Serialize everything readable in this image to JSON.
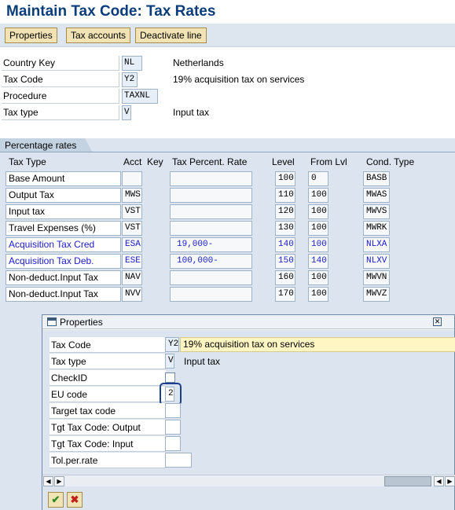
{
  "title": "Maintain Tax Code: Tax Rates",
  "toolbar": {
    "properties": "Properties",
    "tax_accounts": "Tax accounts",
    "deactivate_line": "Deactivate line"
  },
  "header": {
    "country_key_label": "Country Key",
    "country_key_value": "NL",
    "country_name": "Netherlands",
    "tax_code_label": "Tax Code",
    "tax_code_value": "Y2",
    "tax_code_desc": "19% acquisition tax on services",
    "procedure_label": "Procedure",
    "procedure_value": "TAXNL",
    "tax_type_label": "Tax type",
    "tax_type_value": "V",
    "tax_type_desc": "Input tax"
  },
  "rates": {
    "tab_label": "Percentage rates",
    "columns": {
      "tax_type": "Tax Type",
      "acct_key": "Acct  Key",
      "rate": "Tax Percent. Rate",
      "level": "Level",
      "from_lvl": "From Lvl",
      "cond_type": "Cond. Type"
    },
    "rows": [
      {
        "tax_type": "Base Amount",
        "acct_key": "",
        "rate": "",
        "level": "100",
        "from_lvl": "0",
        "cond_type": "BASB"
      },
      {
        "tax_type": "Output Tax",
        "acct_key": "MWS",
        "rate": "",
        "level": "110",
        "from_lvl": "100",
        "cond_type": "MWAS"
      },
      {
        "tax_type": "Input tax",
        "acct_key": "VST",
        "rate": "",
        "level": "120",
        "from_lvl": "100",
        "cond_type": "MWVS"
      },
      {
        "tax_type": "Travel Expenses (%)",
        "acct_key": "VST",
        "rate": "",
        "level": "130",
        "from_lvl": "100",
        "cond_type": "MWRK"
      },
      {
        "tax_type": "Acquisition Tax Cred",
        "acct_key": "ESA",
        "rate": "19,000-",
        "level": "140",
        "from_lvl": "100",
        "cond_type": "NLXA"
      },
      {
        "tax_type": "Acquisition Tax Deb.",
        "acct_key": "ESE",
        "rate": "100,000-",
        "level": "150",
        "from_lvl": "140",
        "cond_type": "NLXV"
      },
      {
        "tax_type": "Non-deduct.Input Tax",
        "acct_key": "NAV",
        "rate": "",
        "level": "160",
        "from_lvl": "100",
        "cond_type": "MWVN"
      },
      {
        "tax_type": "Non-deduct.Input Tax",
        "acct_key": "NVV",
        "rate": "",
        "level": "170",
        "from_lvl": "100",
        "cond_type": "MWVZ"
      }
    ],
    "highlight_color": "#1a1acc"
  },
  "dialog": {
    "title": "Properties",
    "tax_code_label": "Tax Code",
    "tax_code_value": "Y2",
    "tax_code_desc": "19% acquisition tax on services",
    "tax_type_label": "Tax type",
    "tax_type_value": "V",
    "tax_type_desc": "Input tax",
    "check_id_label": "CheckID",
    "eu_code_label": "EU code",
    "eu_code_value": "2",
    "target_tax_code_label": "Target tax code",
    "tgt_output_label": "Tgt Tax Code: Output",
    "tgt_input_label": "Tgt Tax Code: Input",
    "tol_label": "Tol.per.rate",
    "confirm_icon": "check-icon",
    "cancel_icon": "cancel-icon"
  }
}
